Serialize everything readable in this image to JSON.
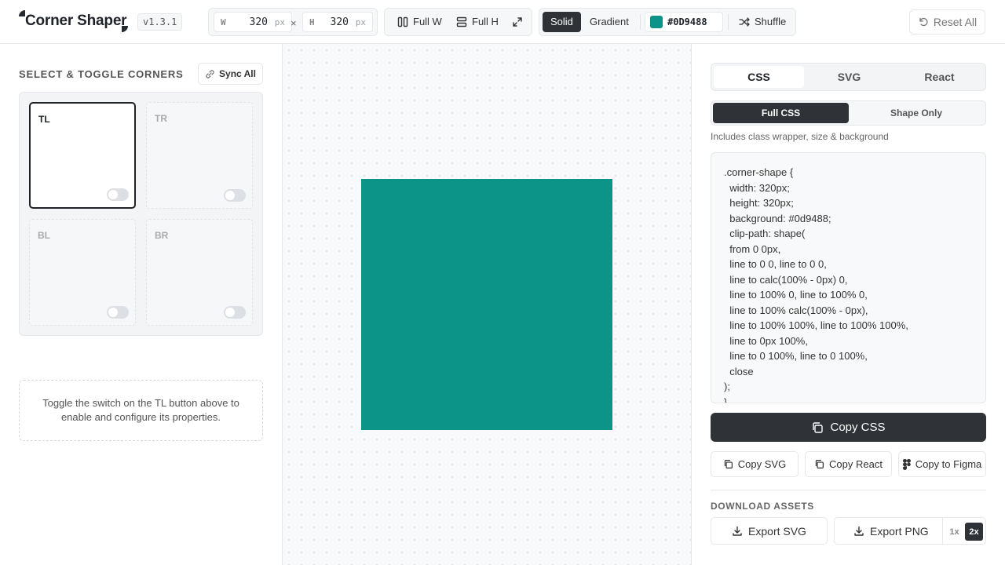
{
  "header": {
    "app_name": "Corner Shaper",
    "version": "v1.3.1",
    "width_letter": "W",
    "width_value": "320",
    "height_letter": "H",
    "height_value": "320",
    "unit": "px",
    "times": "×",
    "full_w_label": "Full W",
    "full_h_label": "Full H",
    "fill_solid_label": "Solid",
    "fill_gradient_label": "Gradient",
    "fill_mode_selected": "Solid",
    "color_hex": "#0D9488",
    "shuffle_label": "Shuffle",
    "reset_label": "Reset All",
    "icons": [
      "columns-icon",
      "rows-icon",
      "expand-icon",
      "shuffle-icon",
      "reset-icon"
    ]
  },
  "left_panel": {
    "title": "SELECT & TOGGLE CORNERS",
    "sync_label": "Sync All",
    "corners": [
      {
        "label": "TL",
        "selected": true,
        "enabled": false
      },
      {
        "label": "TR",
        "selected": false,
        "enabled": false
      },
      {
        "label": "BL",
        "selected": false,
        "enabled": false
      },
      {
        "label": "BR",
        "selected": false,
        "enabled": false
      }
    ],
    "hint": "Toggle the switch on the TL button above to enable and configure its properties."
  },
  "canvas": {
    "shape_color": "#0d9488",
    "width": 320,
    "height": 320
  },
  "right_panel": {
    "tabs": [
      "CSS",
      "SVG",
      "React"
    ],
    "active_tab": "CSS",
    "subtabs": [
      "Full CSS",
      "Shape Only"
    ],
    "active_subtab": "Full CSS",
    "subtab_hint": "Includes class wrapper, size & background",
    "code": ".corner-shape {\n  width: 320px;\n  height: 320px;\n  background: #0d9488;\n  clip-path: shape(\n  from 0 0px,\n  line to 0 0, line to 0 0,\n  line to calc(100% - 0px) 0,\n  line to 100% 0, line to 100% 0,\n  line to 100% calc(100% - 0px),\n  line to 100% 100%, line to 100% 100%,\n  line to 0px 100%,\n  line to 0 100%, line to 0 100%,\n  close\n);\n}",
    "copy_css_label": "Copy CSS",
    "copy_svg_label": "Copy SVG",
    "copy_react_label": "Copy React",
    "copy_figma_label": "Copy to Figma",
    "download_title": "DOWNLOAD ASSETS",
    "export_svg_label": "Export SVG",
    "export_png_label": "Export PNG",
    "scales": [
      "1x",
      "2x"
    ],
    "active_scale": "2x"
  },
  "colors": {
    "accent": "#0d9488",
    "dark": "#2f3237",
    "border": "#e5e7eb"
  }
}
